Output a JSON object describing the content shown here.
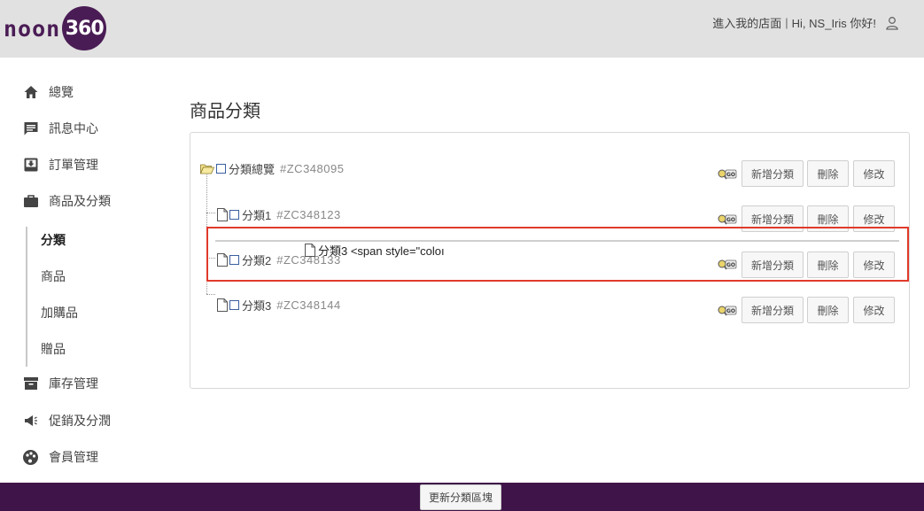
{
  "brand": {
    "logo_text": "noon",
    "logo_circle": "360",
    "color": "#4a1c55"
  },
  "header": {
    "store_link": "進入我的店面",
    "separator": "|",
    "greeting": "Hi, NS_Iris 你好!",
    "user_icon": "user-icon"
  },
  "sidebar": {
    "items": [
      {
        "label": "總覽",
        "icon": "home-icon"
      },
      {
        "label": "訊息中心",
        "icon": "message-icon"
      },
      {
        "label": "訂單管理",
        "icon": "inbox-download-icon"
      },
      {
        "label": "商品及分類",
        "icon": "briefcase-icon"
      },
      {
        "label": "庫存管理",
        "icon": "archive-icon"
      },
      {
        "label": "促銷及分潤",
        "icon": "megaphone-icon"
      },
      {
        "label": "會員管理",
        "icon": "palette-icon"
      }
    ],
    "sub_items": [
      {
        "label": "分類",
        "active": true
      },
      {
        "label": "商品",
        "active": false
      },
      {
        "label": "加購品",
        "active": false
      },
      {
        "label": "贈品",
        "active": false
      }
    ]
  },
  "main": {
    "title": "商品分類",
    "tree": [
      {
        "label": "分類總覽",
        "code": "#ZC348095",
        "icon": "folder-open-icon"
      },
      {
        "label": "分類1",
        "code": "#ZC348123",
        "icon": "document-icon"
      },
      {
        "label": "分類2",
        "code": "#ZC348133",
        "icon": "document-icon"
      },
      {
        "label": "分類3",
        "code": "#ZC348144",
        "icon": "document-icon"
      }
    ],
    "actions": {
      "go": "GO",
      "add": "新增分類",
      "delete": "刪除",
      "edit": "修改"
    },
    "drag_ghost": "分類3 <span style=\"coloı"
  },
  "footer": {
    "update_button": "更新分類區塊"
  },
  "colors": {
    "highlight": "#e03a2a",
    "footer": "#3f1448",
    "header": "#e1e1e1"
  }
}
